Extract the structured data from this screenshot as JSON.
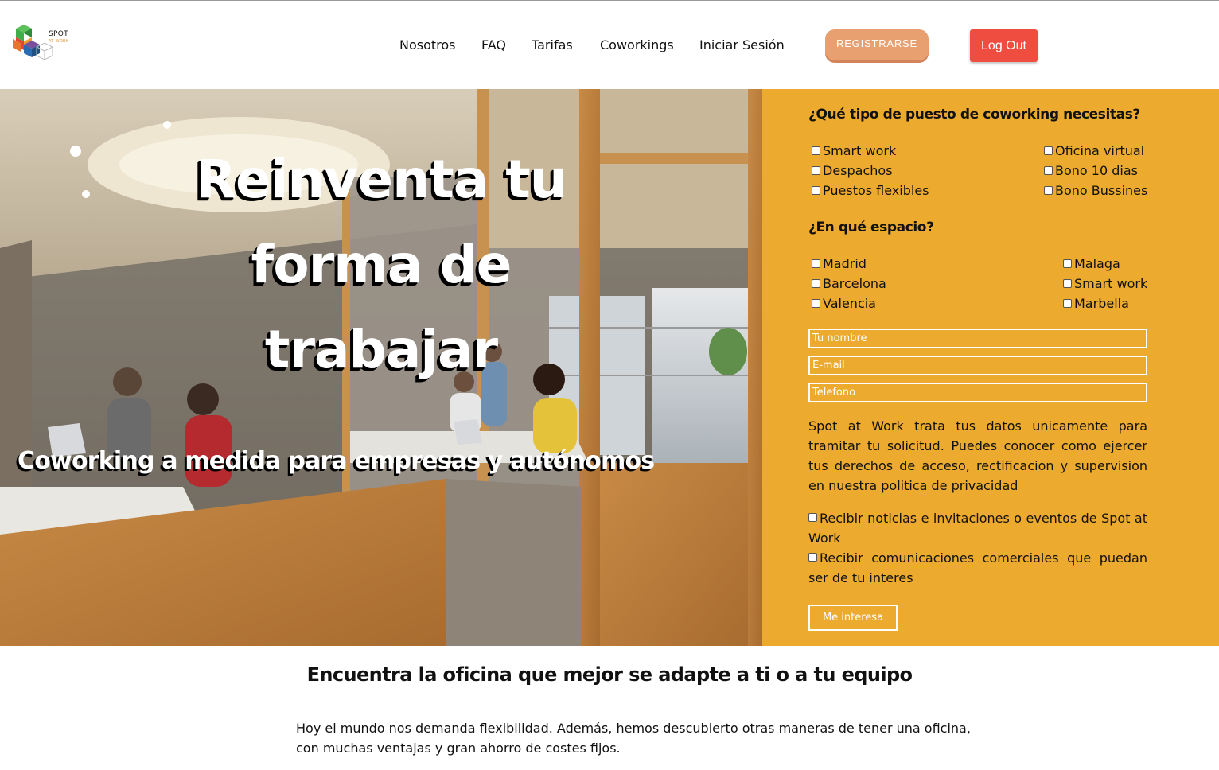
{
  "brand": {
    "name": "SPOT",
    "tagline": "AT WORK",
    "logo_icon": "cube-logo-icon",
    "colors": {
      "green": "#3fae49",
      "orange": "#e0902a",
      "blue": "#2b6cb0",
      "red": "#e2433a"
    }
  },
  "nav": {
    "items": [
      {
        "label": "Nosotros"
      },
      {
        "label": "FAQ"
      },
      {
        "label": "Tarifas"
      },
      {
        "label": "Coworkings"
      },
      {
        "label": "Iniciar Sesión"
      }
    ],
    "register_label": "REGISTRARSE",
    "logout_label": "Log Out",
    "register_color": "#e8a070",
    "logout_color": "#ee4d3f"
  },
  "hero": {
    "title_lines": [
      "Reinventa tu",
      "forma de",
      "trabajar"
    ],
    "subtitle": "Coworking a medida para empresas y autónomos"
  },
  "form": {
    "background": "#ecaa2e",
    "question_type": "¿Qué tipo de puesto de coworking necesitas?",
    "type_options_left": [
      "Smart work",
      "Despachos",
      "Puestos flexibles"
    ],
    "type_options_right": [
      "Oficina virtual",
      "Bono 10 dias",
      "Bono Bussines"
    ],
    "question_space": "¿En qué espacio?",
    "space_options_left": [
      "Madrid",
      "Barcelona",
      "Valencia"
    ],
    "space_options_right": [
      "Malaga",
      "Smart work",
      "Marbella"
    ],
    "name_placeholder": "Tu nombre",
    "email_placeholder": "E-mail",
    "phone_placeholder": "Telefono",
    "privacy_text": "Spot at Work trata tus datos unicamente para tramitar tu solicitud. Puedes conocer como ejercer tus derechos de acceso, rectificacion y supervision en nuestra politica de privacidad",
    "consent_news": "Recibir noticias e invitaciones o eventos de Spot at Work",
    "consent_commercial": "Recibir comunicaciones comerciales que puedan ser de tu interes",
    "submit_label": "Me interesa"
  },
  "section": {
    "title": "Encuentra la oficina que mejor se adapte a ti o a tu equipo",
    "text": "Hoy el mundo nos demanda flexibilidad. Además, hemos descubierto otras maneras de tener una oficina, con muchas ventajas y gran ahorro de costes fijos."
  }
}
